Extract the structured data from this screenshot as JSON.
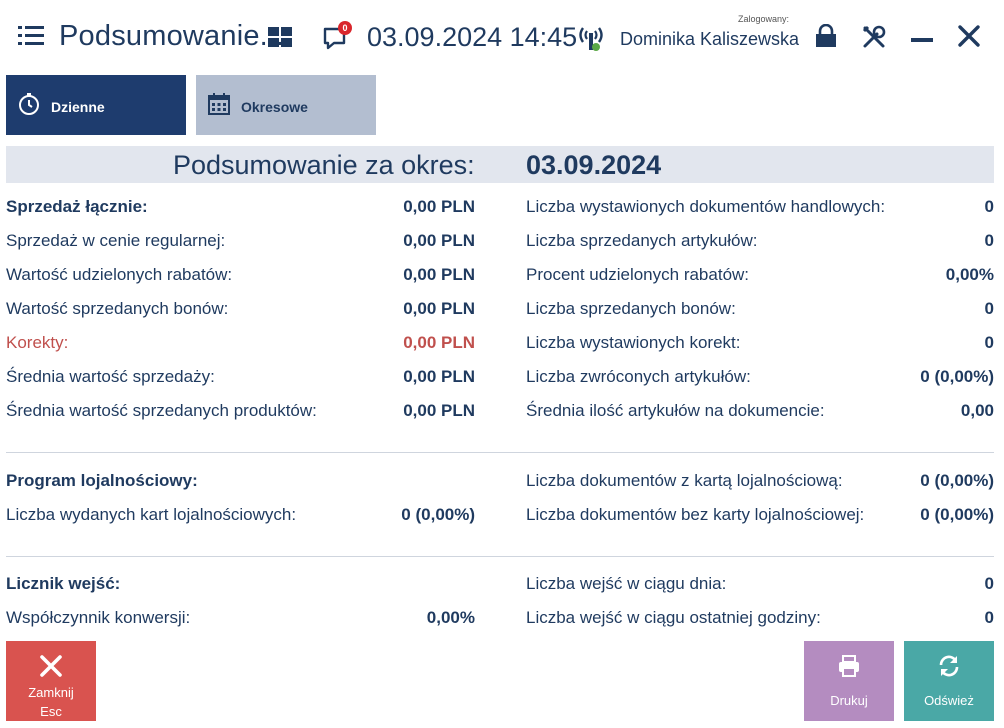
{
  "header": {
    "title": "Podsumowanie...",
    "notification_count": "0",
    "datetime": "03.09.2024 14:45",
    "logged_label": "Zalogowany:",
    "user_name": "Dominika Kaliszewska"
  },
  "tabs": {
    "daily": "Dzienne",
    "period": "Okresowe"
  },
  "summary": {
    "label": "Podsumowanie za okres:",
    "date": "03.09.2024"
  },
  "sales_left": [
    {
      "label": "Sprzedaż łącznie:",
      "value": "0,00 PLN"
    },
    {
      "label": "Sprzedaż w cenie regularnej:",
      "value": "0,00 PLN"
    },
    {
      "label": "Wartość udzielonych rabatów:",
      "value": "0,00 PLN"
    },
    {
      "label": "Wartość sprzedanych bonów:",
      "value": "0,00 PLN"
    },
    {
      "label": "Korekty:",
      "value": "0,00 PLN"
    },
    {
      "label": "Średnia wartość sprzedaży:",
      "value": "0,00 PLN"
    },
    {
      "label": "Średnia wartość sprzedanych produktów:",
      "value": "0,00 PLN"
    }
  ],
  "sales_right": [
    {
      "label": "Liczba wystawionych dokumentów handlowych:",
      "value": "0"
    },
    {
      "label": "Liczba sprzedanych artykułów:",
      "value": "0"
    },
    {
      "label": "Procent udzielonych rabatów:",
      "value": "0,00%"
    },
    {
      "label": "Liczba sprzedanych bonów:",
      "value": "0"
    },
    {
      "label": "Liczba wystawionych korekt:",
      "value": "0"
    },
    {
      "label": "Liczba zwróconych artykułów:",
      "value": "0 (0,00%)"
    },
    {
      "label": "Średnia ilość artykułów na dokumencie:",
      "value": "0,00"
    }
  ],
  "loyalty": {
    "title": "Program lojalnościowy:",
    "cards_label": "Liczba wydanych kart lojalnościowych:",
    "cards_value": "0 (0,00%)",
    "with_card_label": "Liczba dokumentów z kartą lojalnościową:",
    "with_card_value": "0 (0,00%)",
    "without_card_label": "Liczba dokumentów bez karty lojalnościowej:",
    "without_card_value": "0 (0,00%)"
  },
  "counter": {
    "title": "Licznik wejść:",
    "conversion_label": "Współczynnik konwersji:",
    "conversion_value": "0,00%",
    "daily_label": "Liczba wejść w ciągu dnia:",
    "daily_value": "0",
    "hour_label": "Liczba wejść w ciągu ostatniej godziny:",
    "hour_value": "0"
  },
  "buttons": {
    "close_label": "Zamknij",
    "close_shortcut": "Esc",
    "print_label": "Drukuj",
    "refresh_label": "Odśwież"
  },
  "colors": {
    "primary": "#1f3a5f",
    "tab_active": "#1e3c6e",
    "tab_inactive": "#b3bed0",
    "correction_red": "#c0504d",
    "close_button": "#d9534f",
    "print_button": "#b48cc0",
    "refresh_button": "#4aa8a6"
  }
}
